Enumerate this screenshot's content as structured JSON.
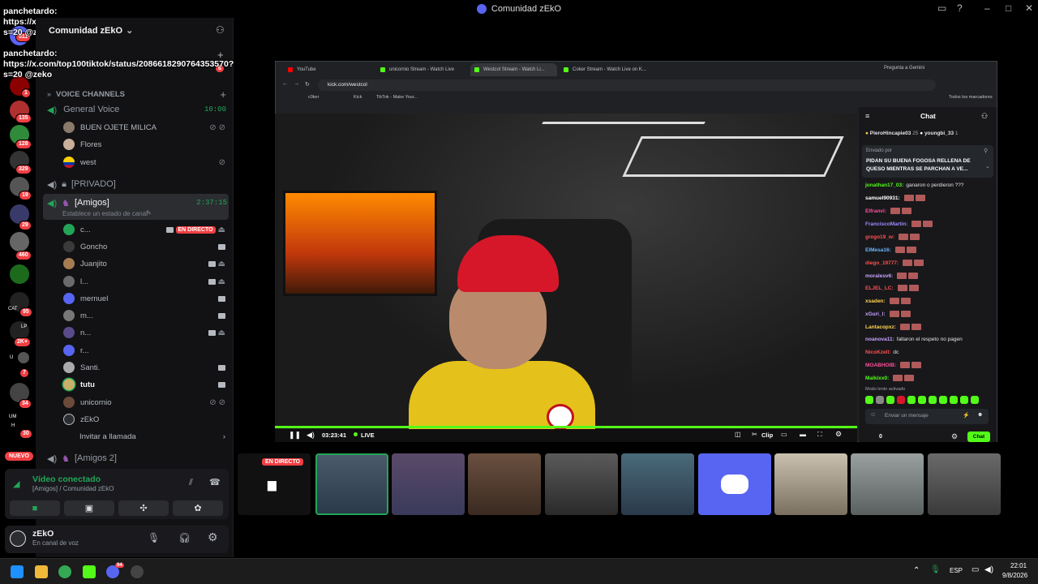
{
  "window": {
    "title": "Comunidad zEkO"
  },
  "overlay_text": "panchetardo: https://x.com/top100tiktok/status/2086618290764353570?s=20 @zeko",
  "server": {
    "name": "Comunidad zEkO",
    "chat_label": "chat",
    "chat_badge": "6"
  },
  "rail_badges": [
    "511",
    "1",
    "135",
    "128",
    "329",
    "19",
    "29",
    "460",
    "95",
    "2K+",
    "7",
    "34",
    "30"
  ],
  "rail_labels": {
    "cat": "CAT",
    "lp": "LP",
    "u": "U",
    "um": "UM",
    "h": "H"
  },
  "sidebar": {
    "voice_section": "VOICE CHANNELS",
    "general_voice": {
      "name": "General Voice",
      "time": "10:00"
    },
    "general_users": [
      "BUEN OJETE MILICA",
      "Flores",
      "west"
    ],
    "privado": "[PRIVADO]",
    "amigos": {
      "name": "[Amigos]",
      "time": "2:37:15",
      "status_placeholder": "Establece un estado de canal"
    },
    "amigos_users": [
      "c...",
      "Goncho",
      "Juanjito",
      "l...",
      "mernuel",
      "m...",
      "n...",
      "r...",
      "Santi.",
      "tutu",
      "unicornio",
      "zEkO"
    ],
    "live_label": "EN DIRECTO",
    "invite": "Invitar a llamada",
    "amigos2": "[Amigos 2]",
    "nuevo": "NUEVO"
  },
  "voice_panel": {
    "status": "Vídeo conectado",
    "location": "[Amigos] / Comunidad zEkO"
  },
  "user_panel": {
    "name": "zEkO",
    "status": "En canal de voz"
  },
  "browser": {
    "tabs": [
      "YouTube",
      "unicornio Stream - Watch Live",
      "Westcol Stream - Watch Li...",
      "Coker Stream - Watch Live on K..."
    ],
    "gemini": "Pregunta a Gemini",
    "url": "kick.com/westcol",
    "bookmarks": [
      "c0ker",
      "Kick",
      "TikTok - Make Your...",
      "Todos los marcadores"
    ]
  },
  "player": {
    "time": "03:23:41",
    "live": "LIVE",
    "clip": "Clip"
  },
  "kick_chat": {
    "title": "Chat",
    "top_users": [
      {
        "name": "PieroHincapie03",
        "count": "25"
      },
      {
        "name": "youngbi_33",
        "count": "1"
      }
    ],
    "pinned_by": "Enviado por",
    "pinned_text": "PIDAN SU BUENA FOGOSA RELLENA DE QUESO MIENTRAS SE PARCHAN A VE...",
    "messages": [
      {
        "user": "jonathan17_03:",
        "text": "ganaron o perdieron ???",
        "color": "#53fc18"
      },
      {
        "user": "samuel90931:",
        "text": "",
        "color": "#ffffff"
      },
      {
        "user": "Elfranvi:",
        "text": "",
        "color": "#ff4f9a"
      },
      {
        "user": "FranciscoMartin:",
        "text": "",
        "color": "#9b8cff"
      },
      {
        "user": "grego19_w:",
        "text": "",
        "color": "#ff4f4f"
      },
      {
        "user": "ElMesa16:",
        "text": "",
        "color": "#6ab7ff"
      },
      {
        "user": "diego_19777:",
        "text": "",
        "color": "#ff4f4f"
      },
      {
        "user": "moralesv6:",
        "text": "",
        "color": "#c8a0ff"
      },
      {
        "user": "ELJEL_LC:",
        "text": "",
        "color": "#ff4f4f"
      },
      {
        "user": "xsaden:",
        "text": "",
        "color": "#ffd34f"
      },
      {
        "user": "xGuri_l:",
        "text": "",
        "color": "#c8a0ff"
      },
      {
        "user": "Lantacopxz:",
        "text": "",
        "color": "#ffd34f"
      },
      {
        "user": "noanova11:",
        "text": "faltaron el respeto no pagen",
        "color": "#c8a0ff"
      },
      {
        "user": "NicoKzell:",
        "text": "dc",
        "color": "#ff4f4f"
      },
      {
        "user": "MOABHOIB:",
        "text": "",
        "color": "#ff4f9a"
      },
      {
        "user": "Malkixx0:",
        "text": "",
        "color": "#53fc18"
      }
    ],
    "slow_mode": "Modo lento activado",
    "input_placeholder": "Enviar un mensaje",
    "count": "0",
    "send": "Chat"
  },
  "strip": {
    "live_label": "EN DIRECTO"
  },
  "taskbar": {
    "lang": "ESP",
    "time": "22:01",
    "date": "9/8/2026",
    "discord_badge": "94"
  }
}
